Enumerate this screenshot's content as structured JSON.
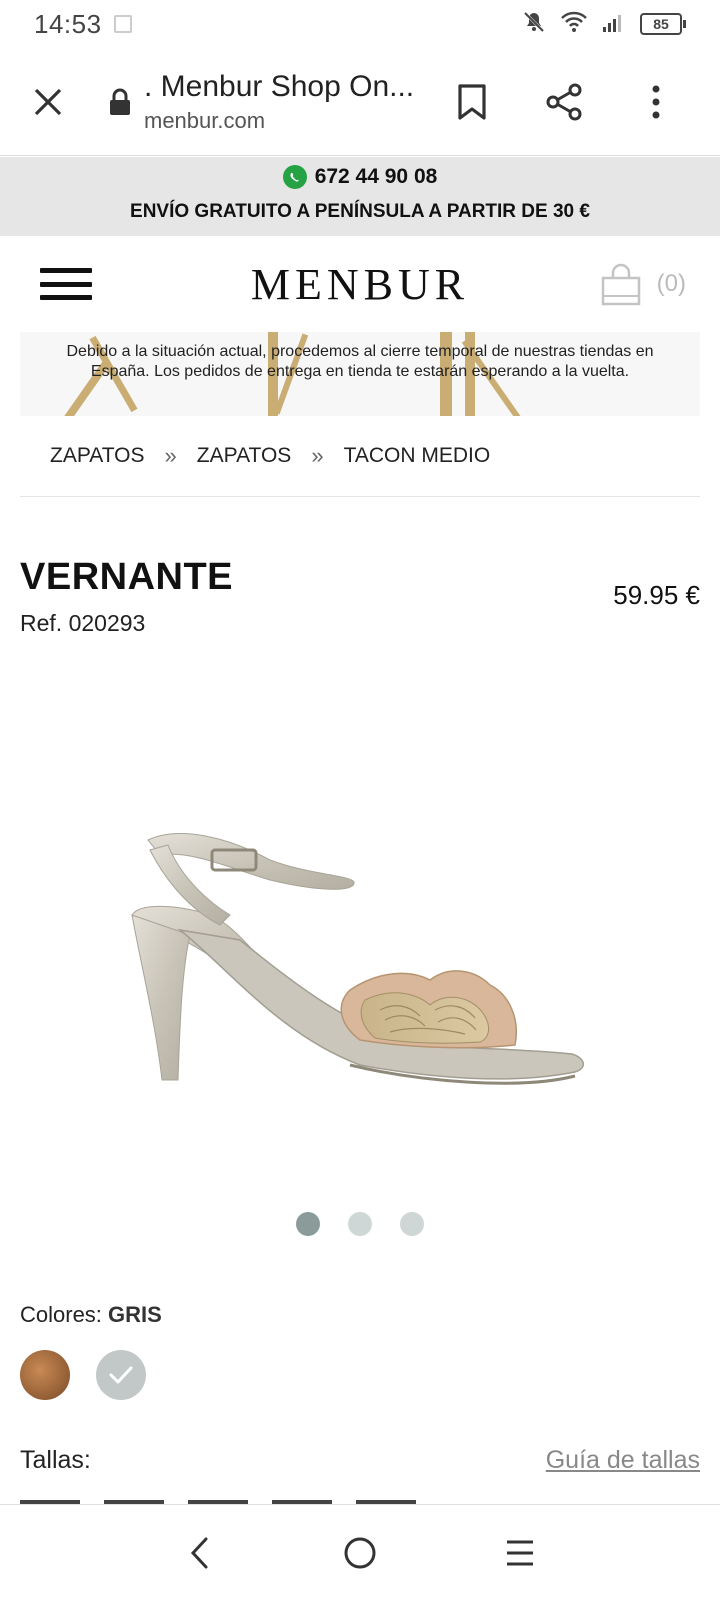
{
  "status_bar": {
    "time": "14:53",
    "battery": "85"
  },
  "browser": {
    "page_title": ". Menbur Shop On...",
    "domain": "menbur.com"
  },
  "promo": {
    "phone": "672 44 90 08",
    "shipping": "ENVÍO GRATUITO A PENÍNSULA A PARTIR DE 30 €"
  },
  "header": {
    "logo": "MENBUR",
    "cart_count": "(0)"
  },
  "notice": {
    "text": "Debido a la situación actual, procedemos al cierre temporal de nuestras tiendas en España. Los pedidos de entrega en tienda te estarán esperando a la vuelta."
  },
  "breadcrumb": {
    "items": [
      "ZAPATOS",
      "ZAPATOS",
      "TACON MEDIO"
    ],
    "separator": "»"
  },
  "product": {
    "name": "VERNANTE",
    "ref": "Ref. 020293",
    "price": "59.95 €",
    "image_count": 3,
    "active_image": 1
  },
  "colors": {
    "label": "Colores:",
    "selected": "GRIS",
    "swatches": [
      {
        "name": "brown",
        "hex": "#9b6035"
      },
      {
        "name": "gris",
        "hex": "#c2c8c8",
        "selected": true
      }
    ]
  },
  "sizes": {
    "label": "Tallas:",
    "guide_link": "Guía de tallas"
  }
}
